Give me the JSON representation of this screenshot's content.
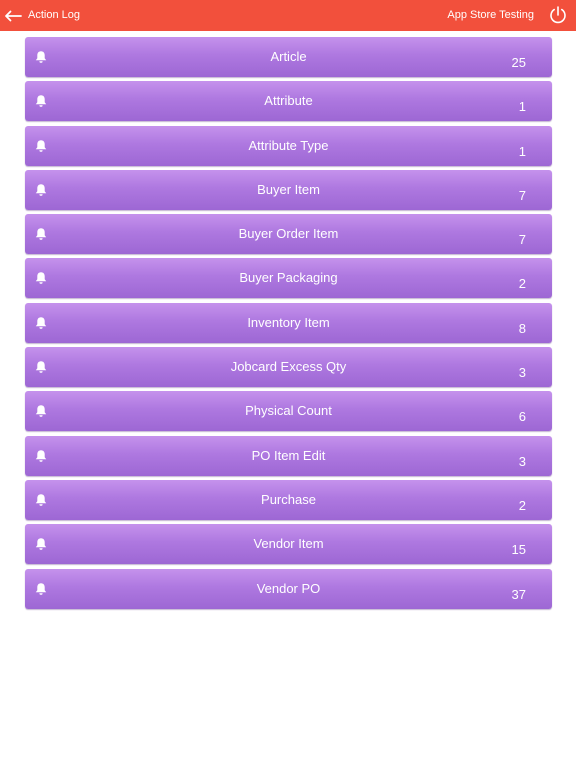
{
  "header": {
    "back_label": "Action Log",
    "app_title": "App Store Testing",
    "back_icon": "arrow-left-icon",
    "power_icon": "power-icon",
    "bar_color": "#f2503c"
  },
  "list": {
    "row_color": "#ae78e0",
    "row_icon": "bell-icon",
    "items": [
      {
        "label": "Article",
        "count": "25"
      },
      {
        "label": "Attribute",
        "count": "1"
      },
      {
        "label": "Attribute Type",
        "count": "1"
      },
      {
        "label": "Buyer Item",
        "count": "7"
      },
      {
        "label": "Buyer Order Item",
        "count": "7"
      },
      {
        "label": "Buyer Packaging",
        "count": "2"
      },
      {
        "label": "Inventory Item",
        "count": "8"
      },
      {
        "label": "Jobcard Excess Qty",
        "count": "3"
      },
      {
        "label": "Physical Count",
        "count": "6"
      },
      {
        "label": "PO Item Edit",
        "count": "3"
      },
      {
        "label": "Purchase",
        "count": "2"
      },
      {
        "label": "Vendor Item",
        "count": "15"
      },
      {
        "label": "Vendor PO",
        "count": "37"
      }
    ]
  }
}
